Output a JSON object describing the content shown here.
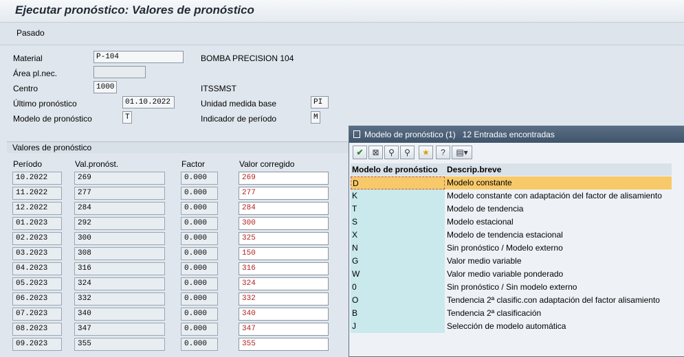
{
  "window": {
    "title": "Ejecutar pronóstico: Valores de pronóstico"
  },
  "toolbar": {
    "pasado": "Pasado"
  },
  "header": {
    "material_label": "Material",
    "material_value": "P-104",
    "material_desc": "BOMBA PRECISION 104",
    "area_label": "Área pl.nec.",
    "area_value": "",
    "centro_label": "Centro",
    "centro_value": "1000",
    "centro_desc": "ITSSMST",
    "ultimo_label": "Último pronóstico",
    "ultimo_value": "01.10.2022",
    "unidad_label": "Unidad medida base",
    "unidad_value": "PI",
    "modelo_label": "Modelo de pronóstico",
    "modelo_value": "T",
    "indicador_label": "Indicador de período",
    "indicador_value": "M"
  },
  "values_section": {
    "title": "Valores de pronóstico",
    "columns": [
      "Período",
      "Val.pronóst.",
      "Factor",
      "Valor corregido"
    ],
    "rows": [
      {
        "periodo": "10.2022",
        "val": "269",
        "factor": "0.000",
        "corr": "269"
      },
      {
        "periodo": "11.2022",
        "val": "277",
        "factor": "0.000",
        "corr": "277"
      },
      {
        "periodo": "12.2022",
        "val": "284",
        "factor": "0.000",
        "corr": "284"
      },
      {
        "periodo": "01.2023",
        "val": "292",
        "factor": "0.000",
        "corr": "300"
      },
      {
        "periodo": "02.2023",
        "val": "300",
        "factor": "0.000",
        "corr": "325"
      },
      {
        "periodo": "03.2023",
        "val": "308",
        "factor": "0.000",
        "corr": "150"
      },
      {
        "periodo": "04.2023",
        "val": "316",
        "factor": "0.000",
        "corr": "316"
      },
      {
        "periodo": "05.2023",
        "val": "324",
        "factor": "0.000",
        "corr": "324"
      },
      {
        "periodo": "06.2023",
        "val": "332",
        "factor": "0.000",
        "corr": "332"
      },
      {
        "periodo": "07.2023",
        "val": "340",
        "factor": "0.000",
        "corr": "340"
      },
      {
        "periodo": "08.2023",
        "val": "347",
        "factor": "0.000",
        "corr": "347"
      },
      {
        "periodo": "09.2023",
        "val": "355",
        "factor": "0.000",
        "corr": "355"
      }
    ]
  },
  "popup": {
    "title": "Modelo de pronóstico (1)   12 Entradas encontradas",
    "toolbar_icons": [
      "check-icon",
      "cancel-icon",
      "find-icon",
      "find-next-icon",
      "favorites-icon",
      "help-icon",
      "print-icon"
    ],
    "col_key": "Modelo de pronóstico",
    "col_desc": "Descrip.breve",
    "rows": [
      {
        "key": "D",
        "desc": "Modelo constante"
      },
      {
        "key": "K",
        "desc": "Modelo constante con adaptación del factor de alisamiento"
      },
      {
        "key": "T",
        "desc": "Modelo de tendencia"
      },
      {
        "key": "S",
        "desc": "Modelo estacional"
      },
      {
        "key": "X",
        "desc": "Modelo de tendencia estacional"
      },
      {
        "key": "N",
        "desc": "Sin pronóstico / Modelo externo"
      },
      {
        "key": "G",
        "desc": "Valor medio variable"
      },
      {
        "key": "W",
        "desc": "Valor medio variable ponderado"
      },
      {
        "key": "0",
        "desc": "Sin pronóstico / Sin modelo externo"
      },
      {
        "key": "O",
        "desc": "Tendencia 2ª clasific.con adaptación del factor alisamiento"
      },
      {
        "key": "B",
        "desc": "Tendencia 2ª clasificación"
      },
      {
        "key": "J",
        "desc": "Selección de modelo automática"
      }
    ],
    "selected_index": 0
  }
}
